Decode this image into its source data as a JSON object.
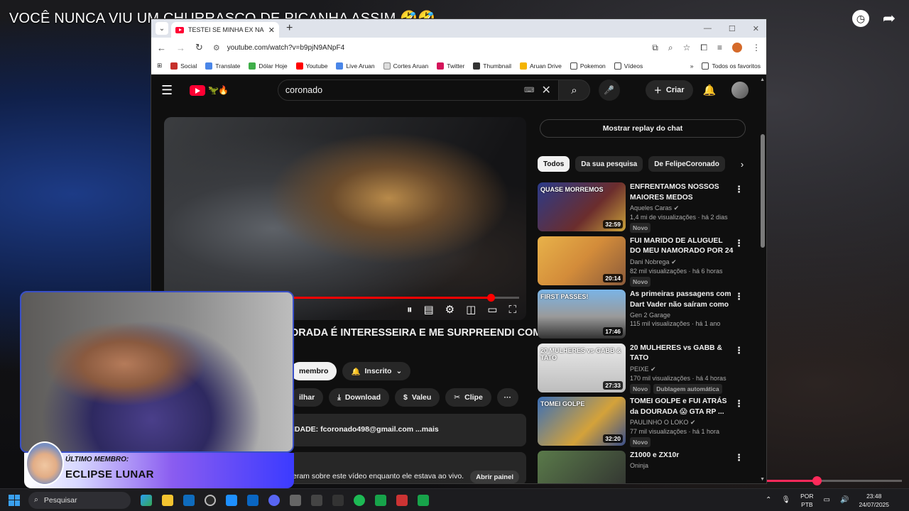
{
  "stream": {
    "title": "VOCÊ NUNCA VIU UM CHURRASCO DE PICANHA ASSIM 🤣🤣",
    "clock_icon": "clock-icon",
    "share_icon": "share-arrow-icon",
    "progress": 0.37
  },
  "browser": {
    "tab_title": "TESTEI SE MINHA EX NAMORADA É INTERESSEIRA",
    "url": "youtube.com/watch?v=b9pjN9ANpF4",
    "bookmarks": [
      "Social",
      "Translate",
      "Dólar Hoje",
      "Youtube",
      "Live Aruan",
      "Cortes Aruan",
      "Twitter",
      "Thumbnail",
      "Aruan Drive",
      "Pokemon",
      "Vídeos"
    ],
    "all_bookmarks": "Todos os favoritos",
    "chevron": "»"
  },
  "youtube": {
    "search_query": "coronado",
    "create_label": "Criar",
    "video_title": "ORADA É INTERESSEIRA E ME SURPREENDI COM",
    "member_btn": "membro",
    "subscribed_btn": "Inscrito",
    "actions": [
      "ilhar",
      "Download",
      "Valeu",
      "Clipe"
    ],
    "description": "IDADE: fcoronado498@gmail.com ...mais",
    "chat_note": "eram sobre este vídeo enquanto ele estava ao vivo.",
    "open_panel": "Abrir painel",
    "replay_chat": "Mostrar replay do chat",
    "chips": [
      "Todos",
      "Da sua pesquisa",
      "De FelipeCoronado"
    ],
    "progress": 0.92,
    "recommendations": [
      {
        "title": "ENFRENTAMOS NOSSOS MAIORES MEDOS",
        "channel": "Aqueles Caras",
        "verified": true,
        "meta": "1,4 mi de visualizações · há 2 dias",
        "duration": "32:59",
        "badges": [
          "Novo"
        ],
        "thumb_text": "QUASE MORREMOS"
      },
      {
        "title": "FUI MARIDO DE ALUGUEL DO MEU NAMORADO POR 24 ...",
        "channel": "Dani Nobrega",
        "verified": true,
        "meta": "82 mil visualizações · há 6 horas",
        "duration": "20:14",
        "badges": [
          "Novo"
        ],
        "thumb_text": ""
      },
      {
        "title": "As primeiras passagens com Dart Vader não saíram como ...",
        "channel": "Gen 2 Garage",
        "verified": false,
        "meta": "115 mil visualizações · há 1 ano",
        "duration": "17:46",
        "badges": [],
        "thumb_text": "FIRST PASSES!"
      },
      {
        "title": "20 MULHERES vs GABB & TATO",
        "channel": "PEIXE",
        "verified": true,
        "meta": "170 mil visualizações · há 4 horas",
        "duration": "27:33",
        "badges": [
          "Novo",
          "Dublagem automática"
        ],
        "thumb_text": "20 MULHERES vs GABB & TATO"
      },
      {
        "title": "TOMEI GOLPE e FUI ATRÁS da DOURADA 😱 GTA RP ...",
        "channel": "PAULINHO O LOKO",
        "verified": true,
        "meta": "77 mil visualizações · há 1 hora",
        "duration": "32:20",
        "badges": [
          "Novo"
        ],
        "thumb_text": "TOMEI GOLPE"
      },
      {
        "title": "Z1000 e ZX10r",
        "channel": "Oninja",
        "verified": false,
        "meta": "",
        "duration": "",
        "badges": [],
        "thumb_text": ""
      }
    ]
  },
  "overlay": {
    "member_label": "ÚLTIMO MEMBRO:",
    "member_name": "ECLIPSE LUNAR"
  },
  "taskbar": {
    "search_label": "Pesquisar",
    "lang_top": "POR",
    "lang_bottom": "PTB",
    "time": "23:48",
    "date": "24/07/2025"
  }
}
